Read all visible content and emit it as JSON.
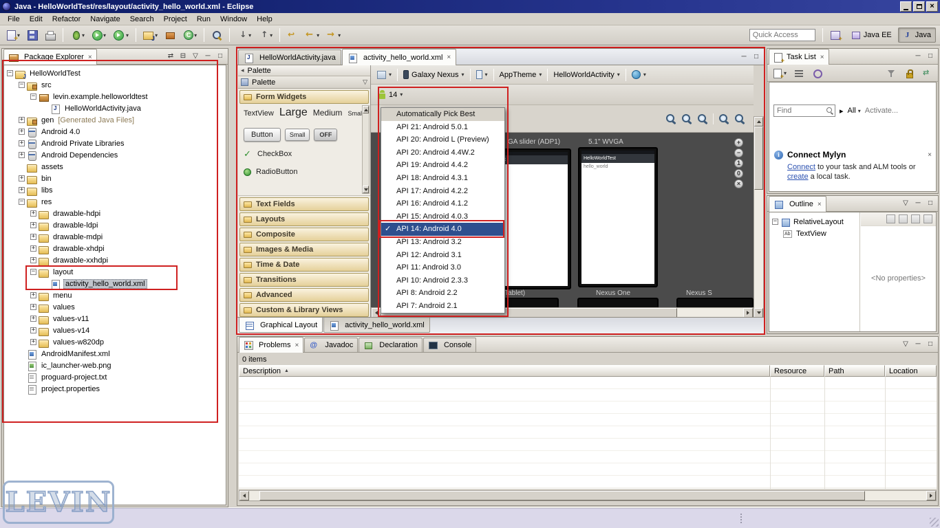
{
  "icons": {
    "close": "×",
    "check": "✓",
    "caret_down": "▾",
    "caret_right": "▸",
    "view_menu": "▽",
    "collapse_left": "◂",
    "link_editor": "⇄",
    "collapse_all": "⊟",
    "minimize": "─",
    "maximize": "□",
    "sort_asc": "▲",
    "plus": "+",
    "minus": "−",
    "one": "1",
    "zero": "0"
  },
  "window": {
    "title": "Java - HelloWorldTest/res/layout/activity_hello_world.xml - Eclipse"
  },
  "menu_bar": {
    "items": [
      "File",
      "Edit",
      "Refactor",
      "Navigate",
      "Search",
      "Project",
      "Run",
      "Window",
      "Help"
    ]
  },
  "toolbar": {
    "quick_access_placeholder": "Quick Access",
    "buttons": [
      {
        "name": "new-wizard",
        "dropdown": true
      },
      {
        "name": "save"
      },
      {
        "name": "print"
      },
      {
        "name": "sep"
      },
      {
        "name": "debug",
        "dropdown": true
      },
      {
        "name": "run",
        "dropdown": true
      },
      {
        "name": "external-tools",
        "dropdown": true
      },
      {
        "name": "sep"
      },
      {
        "name": "new-java-project",
        "dropdown": true
      },
      {
        "name": "new-package"
      },
      {
        "name": "new-class",
        "dropdown": true
      },
      {
        "name": "sep"
      },
      {
        "name": "search"
      },
      {
        "name": "sep"
      },
      {
        "name": "next-annotation",
        "dropdown": true
      },
      {
        "name": "prev-annotation",
        "dropdown": true
      },
      {
        "name": "sep"
      },
      {
        "name": "last-edit"
      },
      {
        "name": "back",
        "dropdown": true
      },
      {
        "name": "forward",
        "dropdown": true
      }
    ],
    "perspectives": [
      {
        "label": "Java EE",
        "active": false
      },
      {
        "label": "Java",
        "active": true
      }
    ]
  },
  "package_explorer": {
    "title": "Package Explorer",
    "items": [
      {
        "label": "HelloWorldTest",
        "depth": 0,
        "icon": "project",
        "exp": "minus"
      },
      {
        "label": "src",
        "depth": 1,
        "icon": "srcfolder",
        "exp": "minus"
      },
      {
        "label": "levin.example.helloworldtest",
        "depth": 2,
        "icon": "package",
        "exp": "minus"
      },
      {
        "label": "HelloWorldActivity.java",
        "depth": 3,
        "icon": "javafile",
        "exp": null
      },
      {
        "label": "gen",
        "suffix": "[Generated Java Files]",
        "depth": 1,
        "icon": "srcfolder",
        "exp": "plus"
      },
      {
        "label": "Android 4.0",
        "depth": 1,
        "icon": "library",
        "exp": "plus"
      },
      {
        "label": "Android Private Libraries",
        "depth": 1,
        "icon": "library",
        "exp": "plus"
      },
      {
        "label": "Android Dependencies",
        "depth": 1,
        "icon": "library",
        "exp": "plus"
      },
      {
        "label": "assets",
        "depth": 1,
        "icon": "folder",
        "exp": null
      },
      {
        "label": "bin",
        "depth": 1,
        "icon": "folder",
        "exp": "plus"
      },
      {
        "label": "libs",
        "depth": 1,
        "icon": "folder",
        "exp": "plus"
      },
      {
        "label": "res",
        "depth": 1,
        "icon": "folder",
        "exp": "minus"
      },
      {
        "label": "drawable-hdpi",
        "depth": 2,
        "icon": "folder",
        "exp": "plus"
      },
      {
        "label": "drawable-ldpi",
        "depth": 2,
        "icon": "folder",
        "exp": "plus"
      },
      {
        "label": "drawable-mdpi",
        "depth": 2,
        "icon": "folder",
        "exp": "plus"
      },
      {
        "label": "drawable-xhdpi",
        "depth": 2,
        "icon": "folder",
        "exp": "plus"
      },
      {
        "label": "drawable-xxhdpi",
        "depth": 2,
        "icon": "folder",
        "exp": "plus"
      },
      {
        "label": "layout",
        "depth": 2,
        "icon": "folder",
        "exp": "minus"
      },
      {
        "label": "activity_hello_world.xml",
        "depth": 3,
        "icon": "xmlfile",
        "exp": null,
        "selected": true
      },
      {
        "label": "menu",
        "depth": 2,
        "icon": "folder",
        "exp": "plus"
      },
      {
        "label": "values",
        "depth": 2,
        "icon": "folder",
        "exp": "plus"
      },
      {
        "label": "values-v11",
        "depth": 2,
        "icon": "folder",
        "exp": "plus"
      },
      {
        "label": "values-v14",
        "depth": 2,
        "icon": "folder",
        "exp": "plus"
      },
      {
        "label": "values-w820dp",
        "depth": 2,
        "icon": "folder",
        "exp": "plus"
      },
      {
        "label": "AndroidManifest.xml",
        "depth": 1,
        "icon": "xmlfile",
        "exp": null
      },
      {
        "label": "ic_launcher-web.png",
        "depth": 1,
        "icon": "imagefile",
        "exp": null
      },
      {
        "label": "proguard-project.txt",
        "depth": 1,
        "icon": "textfile",
        "exp": null
      },
      {
        "label": "project.properties",
        "depth": 1,
        "icon": "textfile",
        "exp": null
      }
    ]
  },
  "editor": {
    "tabs": [
      {
        "label": "HelloWorldActivity.java"
      },
      {
        "label": "activity_hello_world.xml"
      }
    ],
    "config_bar": {
      "device": "Galaxy Nexus",
      "theme": "AppTheme",
      "activity": "HelloWorldActivity",
      "api_label": "14"
    },
    "api_dropdown": [
      {
        "label": "Automatically Pick Best",
        "header": true
      },
      {
        "label": "API 21: Android 5.0.1"
      },
      {
        "label": "API 20: Android L (Preview)"
      },
      {
        "label": "API 20: Android 4.4W.2"
      },
      {
        "label": "API 19: Android 4.4.2"
      },
      {
        "label": "API 18: Android 4.3.1"
      },
      {
        "label": "API 17: Android 4.2.2"
      },
      {
        "label": "API 16: Android 4.1.2"
      },
      {
        "label": "API 15: Android 4.0.3"
      },
      {
        "label": "API 14: Android 4.0",
        "selected": true,
        "checked": true
      },
      {
        "label": "API 13: Android 3.2"
      },
      {
        "label": "API 12: Android 3.1"
      },
      {
        "label": "API 11: Android 3.0"
      },
      {
        "label": "API 10: Android 2.3.3"
      },
      {
        "label": "API 8: Android 2.2"
      },
      {
        "label": "API 7: Android 2.1"
      }
    ],
    "palette": {
      "collapse_label": "Palette",
      "header": "Palette",
      "form_widgets_title": "Form Widgets",
      "textview_items": [
        {
          "label": "TextView",
          "size": 11
        },
        {
          "label": "Large",
          "size": 16
        },
        {
          "label": "Medium",
          "size": 12
        },
        {
          "label": "Small",
          "size": 9
        }
      ],
      "buttons": [
        {
          "label": "Button"
        },
        {
          "label": "Small"
        },
        {
          "label": "OFF"
        }
      ],
      "checkbox_label": "CheckBox",
      "radio_label": "RadioButton",
      "sections": [
        "Text Fields",
        "Layouts",
        "Composite",
        "Images & Media",
        "Time & Date",
        "Transitions",
        "Advanced",
        "Custom & Library Views"
      ]
    },
    "canvas": {
      "top_labels": [
        "GA slider (ADP1)",
        "5.1\" WVGA"
      ],
      "bottom_labels": [
        "WXGA (Tablet)",
        "Nexus One",
        "Nexus S"
      ],
      "device_title": "HelloWorldTest",
      "device_text": "hello_world"
    },
    "bottom_tabs": [
      {
        "label": "Graphical Layout"
      },
      {
        "label": "activity_hello_world.xml"
      }
    ]
  },
  "task_list": {
    "title": "Task List",
    "find_placeholder": "Find",
    "all_label": "All",
    "activate_label": "Activate...",
    "mylyn": {
      "title": "Connect Mylyn",
      "link1": "Connect",
      "mid": " to your task and ALM tools or ",
      "link2": "create",
      "end": " a local task."
    }
  },
  "outline": {
    "title": "Outline",
    "items": [
      {
        "label": "RelativeLayout"
      },
      {
        "label": "TextView"
      }
    ],
    "no_properties": "<No properties>"
  },
  "problems": {
    "tabs": [
      {
        "label": "Problems"
      },
      {
        "label": "Javadoc"
      },
      {
        "label": "Declaration"
      },
      {
        "label": "Console"
      }
    ],
    "count": "0 items",
    "columns": [
      {
        "label": "Description"
      },
      {
        "label": "Resource"
      },
      {
        "label": "Path"
      },
      {
        "label": "Location"
      }
    ]
  },
  "watermark": "LEVIN"
}
